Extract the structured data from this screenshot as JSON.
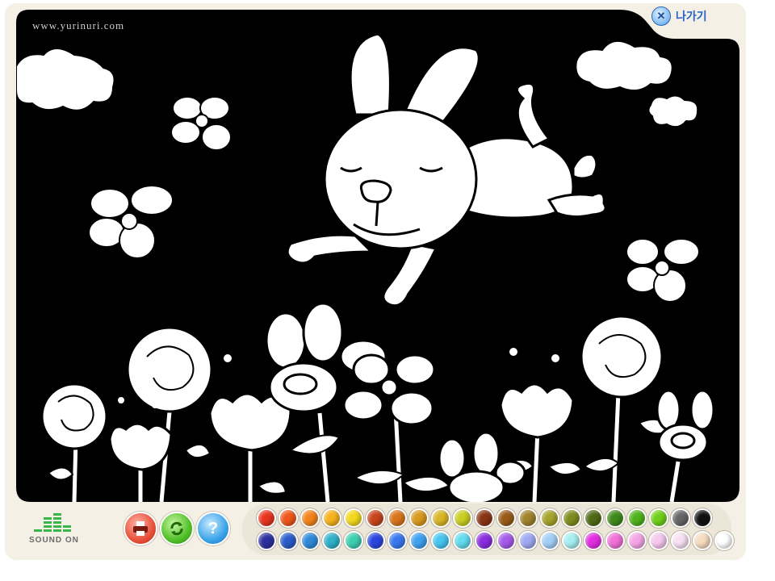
{
  "site_url": "www.yurinuri.com",
  "exit_label": "나가기",
  "exit_icon": "close-x-icon",
  "sound_label": "SOUND ON",
  "tools": {
    "print_icon": "printer-icon",
    "refresh_icon": "refresh-icon",
    "help_symbol": "?"
  },
  "palette": {
    "row1": [
      "#e8351e",
      "#f0561a",
      "#f3831a",
      "#f6b21b",
      "#f2d81c",
      "#c8441b",
      "#d9751b",
      "#d99a1f",
      "#d9b627",
      "#c9cf22",
      "#8a3415",
      "#9a5b18",
      "#a0822a",
      "#a5a42b",
      "#7e8c1f",
      "#4f6a14",
      "#3f8a1a",
      "#4fb31c",
      "#6fd01a",
      "#666666",
      "#111111"
    ],
    "row2": [
      "#2b2f9e",
      "#2a5cc8",
      "#2f89d8",
      "#2fb1c8",
      "#3ecfb0",
      "#2a46e0",
      "#3877ee",
      "#3fa0f0",
      "#46c6f0",
      "#62dcee",
      "#8a2ce0",
      "#a55aea",
      "#9fa8f0",
      "#a3cff6",
      "#a7eef2",
      "#e32ce0",
      "#f070d8",
      "#f6a3e6",
      "#f6c6ee",
      "#f6e0f2",
      "#f6dcc0",
      "#ffffff"
    ]
  }
}
